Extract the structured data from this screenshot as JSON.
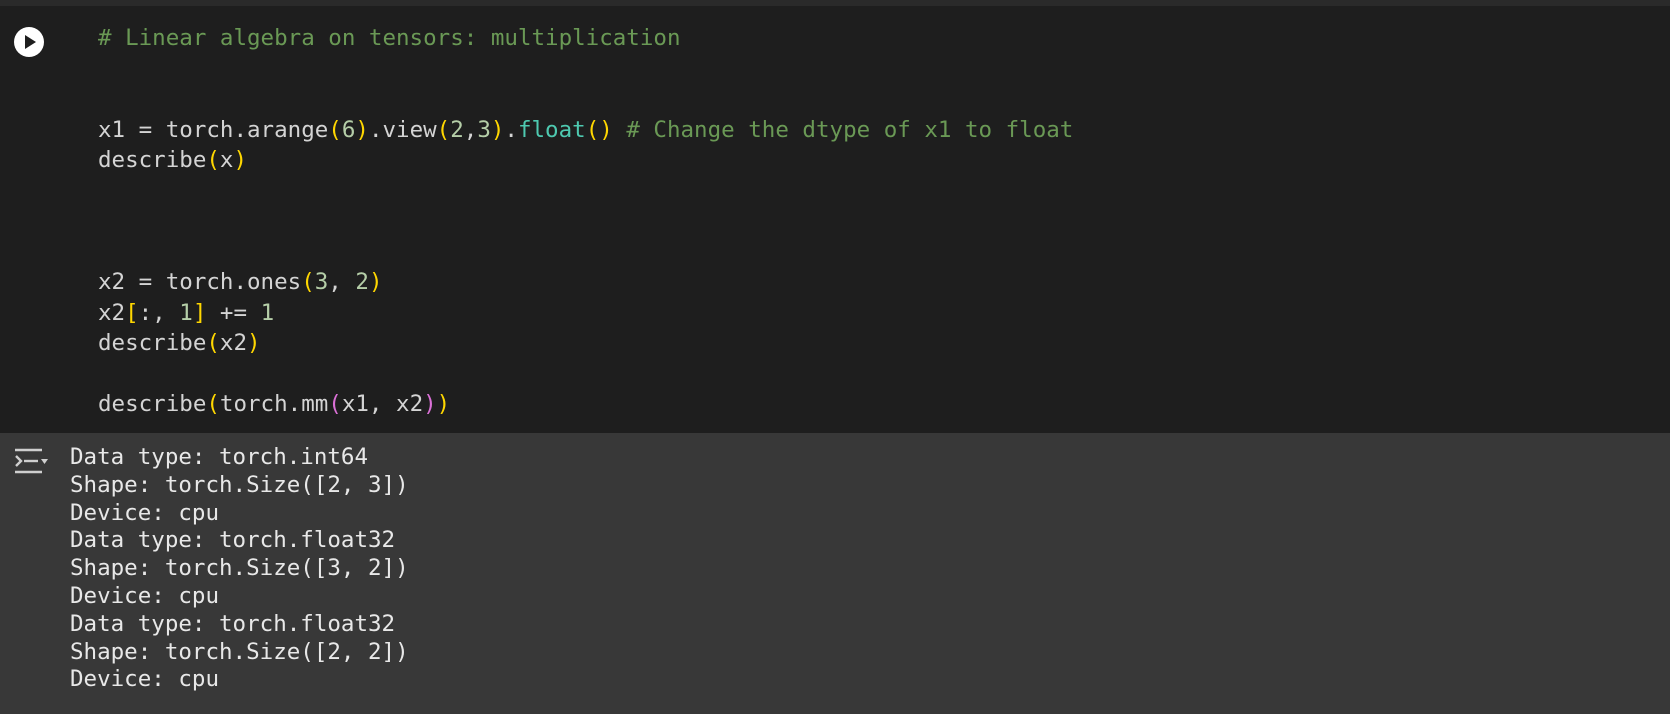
{
  "code_cell": {
    "run_button": "run-cell",
    "lines": [
      [
        {
          "t": "# Linear algebra on tensors: multiplication",
          "c": "comment"
        }
      ],
      [],
      [],
      [
        {
          "t": "x1 = torch.arange",
          "c": "plain"
        },
        {
          "t": "(",
          "c": "b1"
        },
        {
          "t": "6",
          "c": "num"
        },
        {
          "t": ")",
          "c": "b1"
        },
        {
          "t": ".view",
          "c": "plain"
        },
        {
          "t": "(",
          "c": "b1"
        },
        {
          "t": "2",
          "c": "num"
        },
        {
          "t": ",",
          "c": "plain"
        },
        {
          "t": "3",
          "c": "num"
        },
        {
          "t": ")",
          "c": "b1"
        },
        {
          "t": ".",
          "c": "plain"
        },
        {
          "t": "float",
          "c": "fn"
        },
        {
          "t": "()",
          "c": "b1"
        },
        {
          "t": " ",
          "c": "plain"
        },
        {
          "t": "# Change the dtype of x1 to float",
          "c": "comment"
        }
      ],
      [
        {
          "t": "describe",
          "c": "plain"
        },
        {
          "t": "(",
          "c": "b1"
        },
        {
          "t": "x",
          "c": "plain"
        },
        {
          "t": ")",
          "c": "b1"
        }
      ],
      [],
      [],
      [],
      [
        {
          "t": "x2 = torch.ones",
          "c": "plain"
        },
        {
          "t": "(",
          "c": "b1"
        },
        {
          "t": "3",
          "c": "num"
        },
        {
          "t": ", ",
          "c": "plain"
        },
        {
          "t": "2",
          "c": "num"
        },
        {
          "t": ")",
          "c": "b1"
        }
      ],
      [
        {
          "t": "x2",
          "c": "plain"
        },
        {
          "t": "[",
          "c": "b1"
        },
        {
          "t": ":, ",
          "c": "plain"
        },
        {
          "t": "1",
          "c": "num"
        },
        {
          "t": "]",
          "c": "b1"
        },
        {
          "t": " += ",
          "c": "plain"
        },
        {
          "t": "1",
          "c": "num"
        }
      ],
      [
        {
          "t": "describe",
          "c": "plain"
        },
        {
          "t": "(",
          "c": "b1"
        },
        {
          "t": "x2",
          "c": "plain"
        },
        {
          "t": ")",
          "c": "b1"
        }
      ],
      [],
      [
        {
          "t": "describe",
          "c": "plain"
        },
        {
          "t": "(",
          "c": "b1"
        },
        {
          "t": "torch.mm",
          "c": "plain"
        },
        {
          "t": "(",
          "c": "b2"
        },
        {
          "t": "x1, x2",
          "c": "plain"
        },
        {
          "t": ")",
          "c": "b2"
        },
        {
          "t": ")",
          "c": "b1"
        }
      ]
    ]
  },
  "output": {
    "toggle_icon": "output-menu-icon",
    "lines": [
      "Data type: torch.int64",
      "Shape: torch.Size([2, 3])",
      "Device: cpu",
      "Data type: torch.float32",
      "Shape: torch.Size([3, 2])",
      "Device: cpu",
      "Data type: torch.float32",
      "Shape: torch.Size([2, 2])",
      "Device: cpu"
    ]
  },
  "colors": {
    "editor_bg": "#1e1e1e",
    "output_bg": "#383838",
    "comment": "#6a9955",
    "number": "#b5cea8",
    "function": "#4ec9b0",
    "bracket_1": "#ffd700",
    "bracket_2": "#da70d6",
    "text": "#d4d4d4"
  }
}
